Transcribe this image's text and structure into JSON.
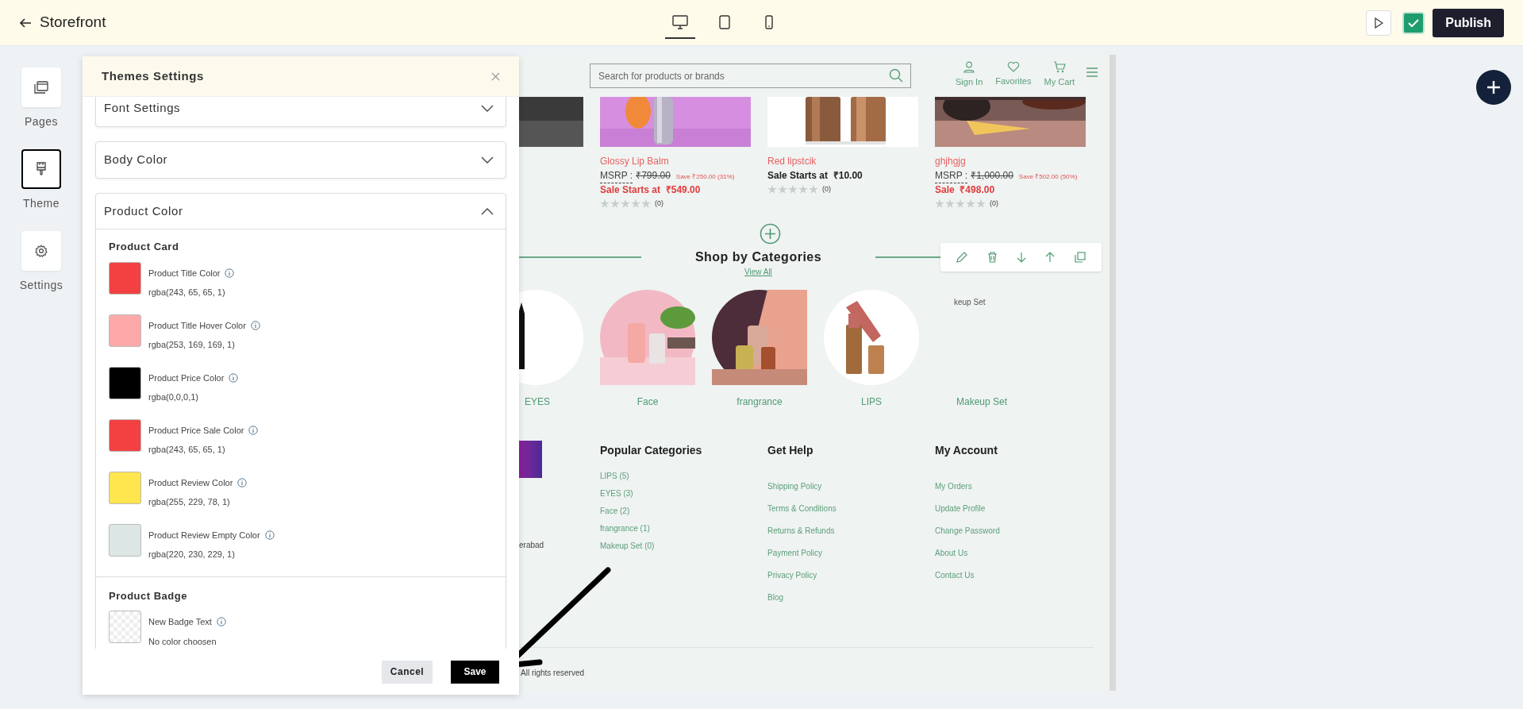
{
  "top_bar": {
    "title": "Storefront",
    "devices": [
      {
        "kind": "desktop",
        "selected": true
      },
      {
        "kind": "tablet",
        "selected": false
      },
      {
        "kind": "mobile",
        "selected": false
      }
    ],
    "publish_button": "Publish"
  },
  "sidebar": {
    "items": [
      {
        "kind": "pages",
        "label": "Pages",
        "selected": false
      },
      {
        "kind": "theme",
        "label": "Theme",
        "selected": true
      },
      {
        "kind": "settings",
        "label": "Settings",
        "selected": false
      }
    ]
  },
  "panel": {
    "title": "Themes Settings",
    "sections": [
      {
        "title": "Font Settings",
        "expanded": false
      },
      {
        "title": "Body Color",
        "expanded": false
      },
      {
        "title": "Product Color",
        "expanded": true,
        "groups": [
          {
            "title": "Product Card",
            "colors": [
              {
                "label": "Product Title Color",
                "value": "rgba(243, 65, 65, 1)",
                "color": "#f34141"
              },
              {
                "label": "Product Title Hover Color",
                "value": "rgba(253, 169, 169, 1)",
                "color": "#fda9a9"
              },
              {
                "label": "Product Price Color",
                "value": "rgba(0,0,0,1)",
                "color": "#000000"
              },
              {
                "label": "Product Price Sale Color",
                "value": "rgba(243, 65, 65, 1)",
                "color": "#f34141"
              },
              {
                "label": "Product Review Color",
                "value": "rgba(255, 229, 78, 1)",
                "color": "#ffe54e"
              },
              {
                "label": "Product Review Empty Color",
                "value": "rgba(220, 230, 229, 1)",
                "color": "#dce6e5"
              }
            ]
          },
          {
            "title": "Product Badge",
            "colors": [
              {
                "label": "New Badge Text",
                "value": "No color choosen"
              }
            ]
          }
        ]
      }
    ],
    "cancel_button": "Cancel",
    "save_button": "Save"
  },
  "preview": {
    "search": {
      "placeholder": "Search for products or brands"
    },
    "header_links": [
      {
        "kind": "user",
        "label": "Sign In"
      },
      {
        "kind": "heart",
        "label": "Favorites"
      },
      {
        "kind": "cart",
        "label": "My Cart"
      }
    ],
    "products": [
      {
        "kind": "picture"
      },
      {
        "kind": "product",
        "name": "Glossy Lip Balm",
        "msrp_label": "MSRP :",
        "msrp": "₹799.00",
        "save": "Save ₹250.00 (31%)",
        "sale_label": "Sale Starts at",
        "price": "₹549.00",
        "on_sale": true,
        "stars": 0,
        "reviews": "(0)"
      },
      {
        "kind": "product",
        "name": "Red lipstcik",
        "sale_label": "Sale Starts at",
        "price": "₹10.00",
        "on_sale": false,
        "stars": 0,
        "reviews": "(0)"
      },
      {
        "kind": "product",
        "name": "ghjhgjg",
        "msrp_label": "MSRP :",
        "msrp": "₹1,000.00",
        "save": "Save ₹502.00 (50%)",
        "sale_label": "Sale",
        "price": "₹498.00",
        "on_sale": true,
        "stars": 0,
        "reviews": "(0)"
      }
    ],
    "section": {
      "title": "Shop by Categories",
      "link": "View All"
    },
    "categories": [
      {
        "kind": "picture",
        "name": "EYES"
      },
      {
        "kind": "picture",
        "name": "Face"
      },
      {
        "kind": "picture",
        "name": "frangrance"
      },
      {
        "kind": "picture",
        "name": "LIPS"
      },
      {
        "kind": "missing",
        "alt_text": "keup Set",
        "name": "Makeup Set"
      }
    ],
    "footer": {
      "address_fragment": "erabad",
      "columns": [
        {
          "title": "Popular Categories",
          "links": [
            "LIPS (5)",
            "EYES (3)",
            "Face (2)",
            "frangrance (1)",
            "Makeup Set (0)"
          ]
        },
        {
          "title": "Get Help",
          "links": [
            "Shipping Policy",
            "Terms & Conditions",
            "Returns & Refunds",
            "Payment Policy",
            "Privacy Policy",
            "Blog"
          ]
        },
        {
          "title": "My Account",
          "links": [
            "My Orders",
            "Update Profile",
            "Change Password",
            "About Us",
            "Contact Us"
          ]
        }
      ],
      "copyright": "All rights reserved"
    }
  }
}
